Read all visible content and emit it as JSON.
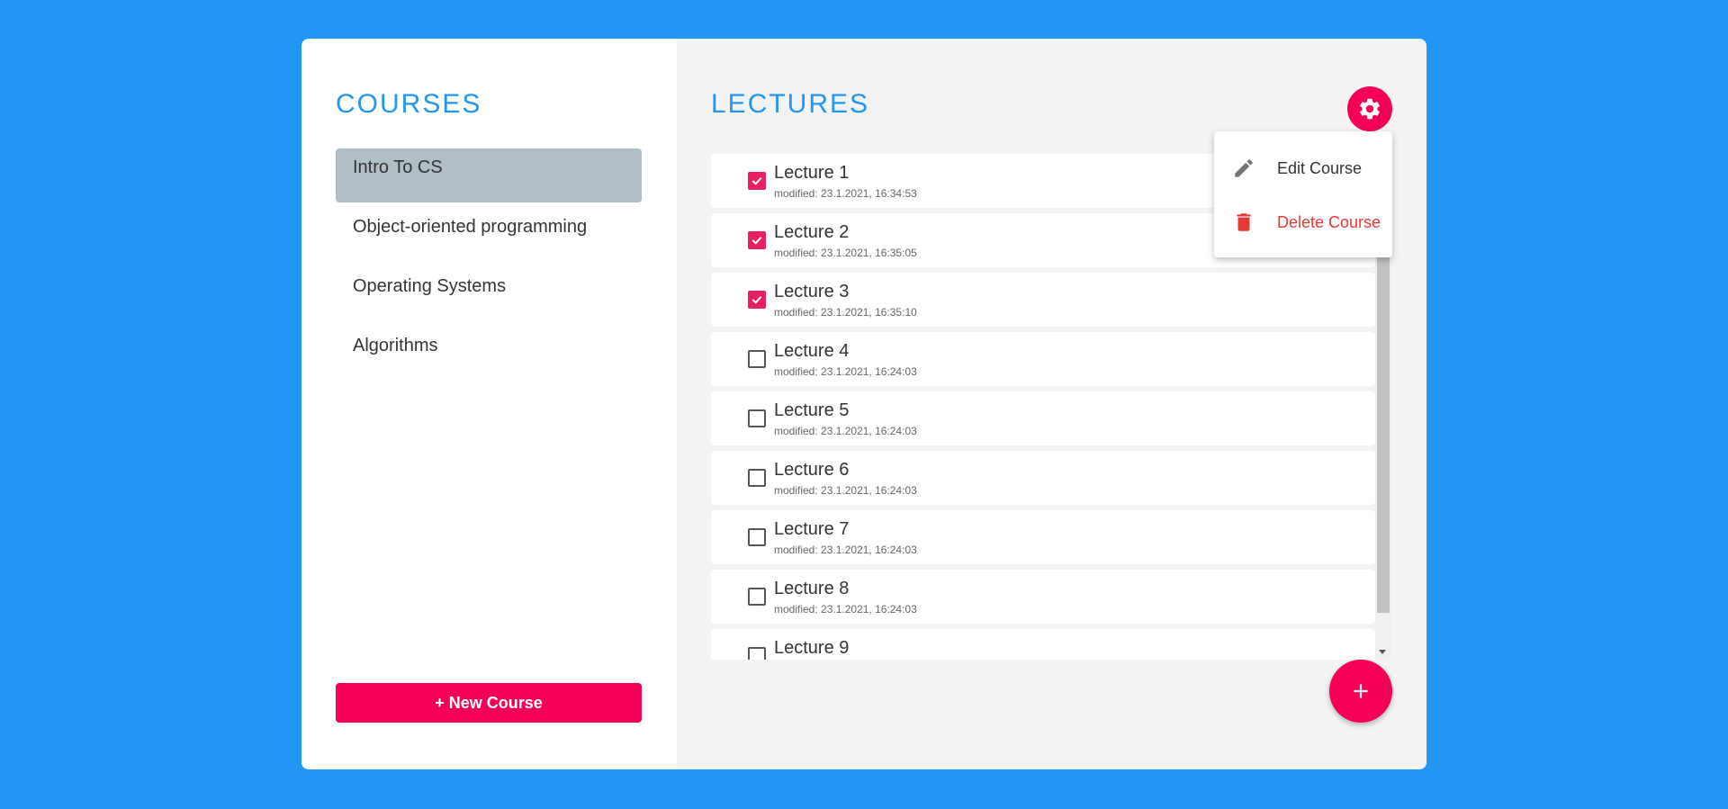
{
  "courses": {
    "title": "COURSES",
    "items": [
      {
        "label": "Intro To CS"
      },
      {
        "label": "Object-oriented programming"
      },
      {
        "label": "Operating Systems"
      },
      {
        "label": "Algorithms"
      }
    ],
    "selected_index": 0,
    "new_course_label": "+ New Course"
  },
  "lectures": {
    "title": "LECTURES",
    "items": [
      {
        "title": "Lecture 1",
        "modified": "modified: 23.1.2021, 16:34:53",
        "checked": true
      },
      {
        "title": "Lecture 2",
        "modified": "modified: 23.1.2021, 16:35:05",
        "checked": true
      },
      {
        "title": "Lecture 3",
        "modified": "modified: 23.1.2021, 16:35:10",
        "checked": true
      },
      {
        "title": "Lecture 4",
        "modified": "modified: 23.1.2021, 16:24:03",
        "checked": false
      },
      {
        "title": "Lecture 5",
        "modified": "modified: 23.1.2021, 16:24:03",
        "checked": false
      },
      {
        "title": "Lecture 6",
        "modified": "modified: 23.1.2021, 16:24:03",
        "checked": false
      },
      {
        "title": "Lecture 7",
        "modified": "modified: 23.1.2021, 16:24:03",
        "checked": false
      },
      {
        "title": "Lecture 8",
        "modified": "modified: 23.1.2021, 16:24:03",
        "checked": false
      },
      {
        "title": "Lecture 9",
        "modified": "",
        "checked": false
      }
    ]
  },
  "settings_menu": {
    "icon": "gear-icon",
    "items": [
      {
        "label": "Edit Course",
        "icon": "pencil-icon"
      },
      {
        "label": "Delete Course",
        "icon": "trash-icon",
        "color": "#e53935"
      }
    ]
  },
  "fab": {
    "icon": "plus-icon"
  },
  "colors": {
    "background": "#2196F3",
    "accent": "#f50057",
    "title": "#2196F3",
    "selected_course": "#b0bec5",
    "checkbox_checked": "#e91e63"
  }
}
